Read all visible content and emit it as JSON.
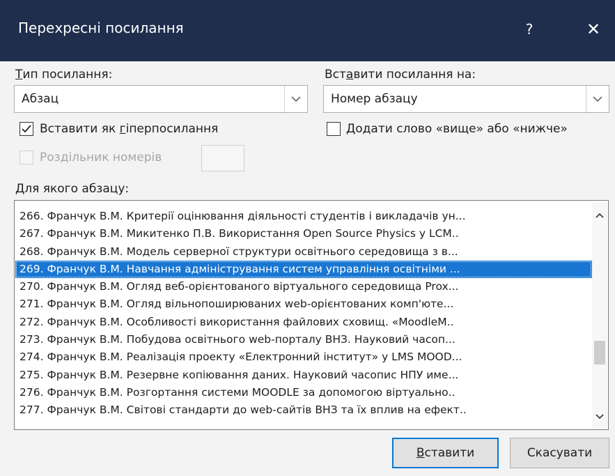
{
  "dialog": {
    "title": "Перехресні посилання",
    "help_label": "?",
    "close_label": "✕"
  },
  "reference_type": {
    "label_u": "Т",
    "label_rest": "ип посилання:",
    "value": "Абзац"
  },
  "insert_reference_to": {
    "label_a": "Вст",
    "label_u": "а",
    "label_rest": "вити посилання на:",
    "value": "Номер абзацу"
  },
  "insert_as_hyperlink": {
    "checked": true,
    "label_a": "Вставити як ",
    "label_u": "г",
    "label_rest": "іперпосилання"
  },
  "include_above_below": {
    "checked": false,
    "label_u": "Д",
    "label_rest": "одати слово «вище» або «нижче»"
  },
  "separate_numbers": {
    "checked": false,
    "disabled": true,
    "label": "Роздільник номерів"
  },
  "which_paragraph": {
    "label_u": "Д",
    "label_rest": "ля якого абзацу:",
    "selected_index": 3,
    "items": [
      "266. Франчук В.М. Критерії оцінювання діяльності студентів і викладачів ун...",
      "267. Франчук В.М. Микитенко П.В. Використання Open Source Physics у LCM..",
      "268. Франчук В.М. Модель серверної структури освітнього середовища з в...",
      "269. Франчук В.М. Навчання адміністрування систем управління освітніми ...",
      "270. Франчук В.М. Огляд веб-орієнтованого віртуального середовища Prox...",
      "271. Франчук В.М. Огляд вільнопоширюваних web-орієнтованих комп'юте...",
      "272. Франчук В.М. Особливості використання файлових сховищ. «MoodleM..",
      "273. Франчук В.М. Побудова освітнього web-порталу ВНЗ. Науковий часоп...",
      "274. Франчук В.М. Реалізація проекту «Електронний інститут» у LMS MOOD...",
      "275. Франчук В.М. Резервне копіювання даних. Науковий часопис НПУ име...",
      "276. Франчук В.М. Розгортання системи MOODLE за допомогою віртуально..",
      "277. Франчук В.М. Світові стандарти до web-сайтів ВНЗ та їх вплив на ефект.."
    ]
  },
  "buttons": {
    "insert_u": "В",
    "insert_rest": "ставити",
    "cancel": "Скасувати"
  },
  "colors": {
    "titlebar": "#1f2e4d",
    "selection": "#1976d2",
    "default_button_border": "#0078d7"
  }
}
